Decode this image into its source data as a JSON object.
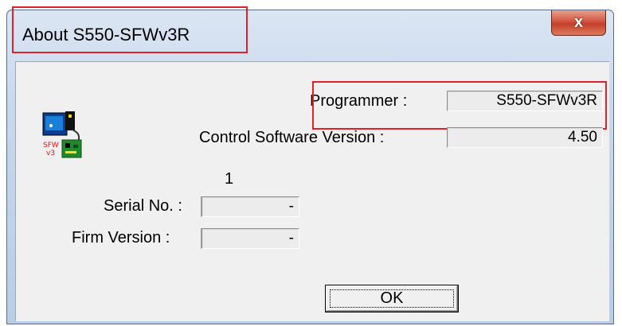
{
  "window": {
    "title": "About S550-SFWv3R",
    "close_glyph": "x"
  },
  "icon": {
    "name": "programmer-device-icon",
    "caption": "SFW v3"
  },
  "info": {
    "programmer_label": "Programmer :",
    "programmer_value": "S550-SFWv3R",
    "control_software_label": "Control Software Version :",
    "control_software_value": "4.50",
    "count": "1",
    "serial_label": "Serial No. :",
    "serial_value": "-",
    "firm_label": "Firm Version :",
    "firm_value": "-"
  },
  "ok_label": "OK",
  "colors": {
    "highlight": "#e0202a",
    "close_button": "#c2402b",
    "titlebar": "#c8d8ec",
    "client_bg": "#f0f0f0"
  }
}
